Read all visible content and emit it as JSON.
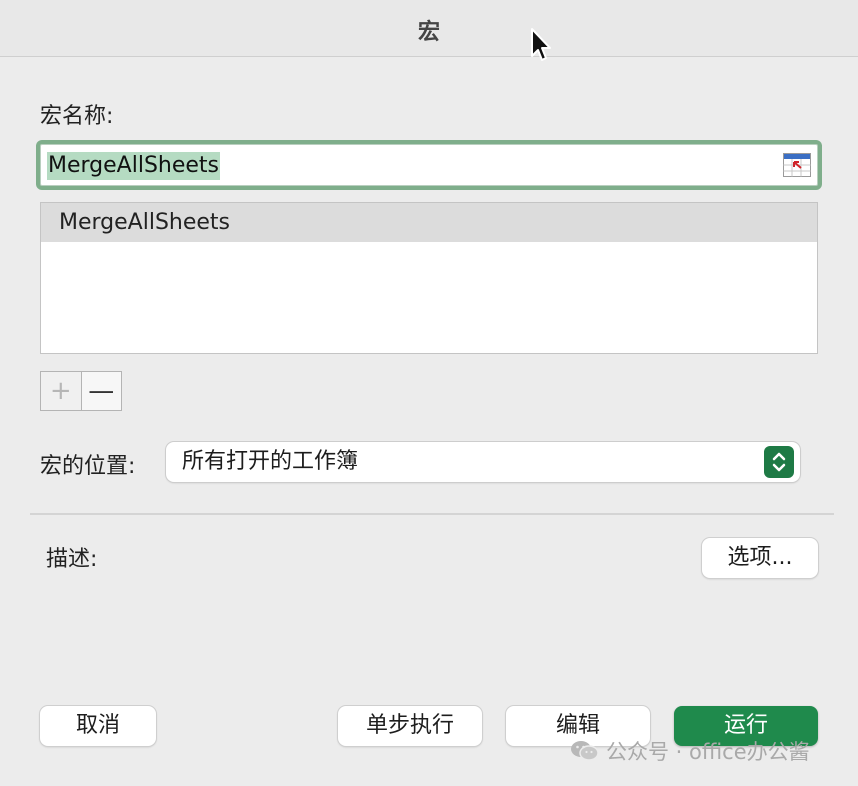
{
  "dialog": {
    "title": "宏"
  },
  "macro_name": {
    "label": "宏名称:",
    "value": "MergeAllSheets"
  },
  "macro_list": {
    "items": [
      "MergeAllSheets"
    ],
    "selected_index": 0
  },
  "list_controls": {
    "add_symbol": "+",
    "remove_symbol": "—"
  },
  "location": {
    "label": "宏的位置:",
    "selected": "所有打开的工作簿"
  },
  "description": {
    "label": "描述:"
  },
  "buttons": {
    "options": "选项...",
    "cancel": "取消",
    "step": "单步执行",
    "edit": "编辑",
    "run": "运行"
  },
  "watermark": {
    "text": "公众号 · office办公酱"
  },
  "colors": {
    "accent": "#1f8a4c",
    "focus_ring": "#7fae8b",
    "selection": "#b5dbc2"
  }
}
